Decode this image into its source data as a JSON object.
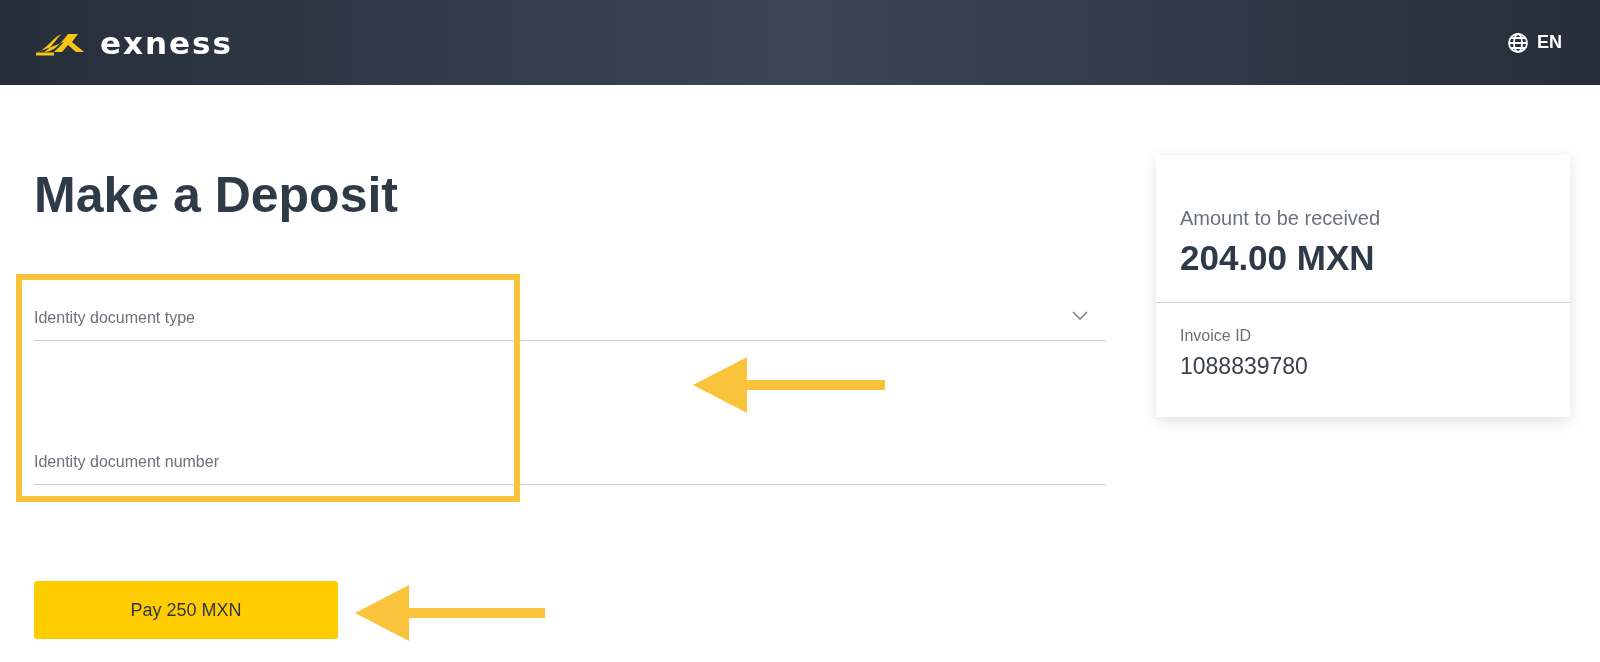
{
  "header": {
    "logo": "exness",
    "language": "EN"
  },
  "title": "Make a Deposit",
  "fields": [
    {
      "kind": "select",
      "placeholder": "Identity document type"
    },
    {
      "kind": "text",
      "placeholder": "Identity document number"
    }
  ],
  "pay_button": "Pay 250 MXN",
  "summary": {
    "amount_label": "Amount to be received",
    "amount": "204.00 MXN",
    "invoice_label": "Invoice ID",
    "invoice_id": "1088839780"
  }
}
